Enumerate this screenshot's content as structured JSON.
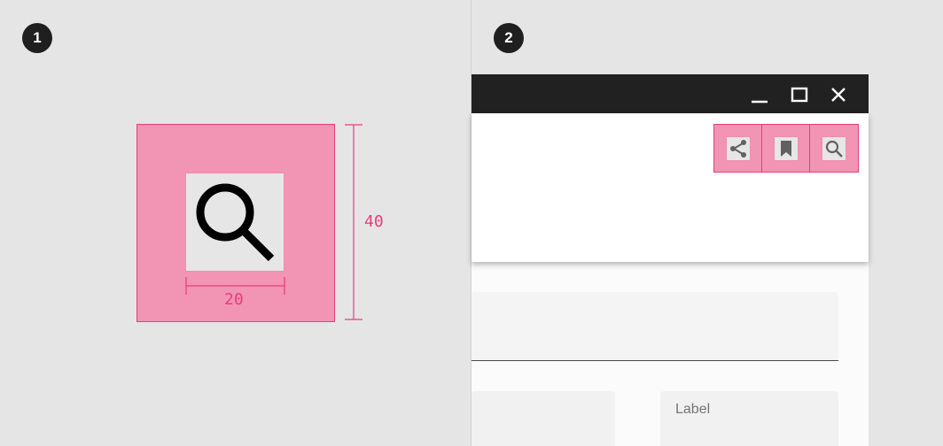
{
  "panel_left": {
    "step_number": "1",
    "icon_size_label": "20",
    "touch_target_label": "40",
    "icon": "search-icon",
    "colors": {
      "touch_target_fill": "#f294b4",
      "measure_line": "#e63e7c"
    }
  },
  "panel_right": {
    "step_number": "2",
    "window_controls": [
      "minimize-icon",
      "maximize-icon",
      "close-icon"
    ],
    "app_bar_actions": [
      "share-icon",
      "bookmark-icon",
      "search-icon"
    ],
    "text_field": {
      "label": "Label"
    },
    "colors": {
      "title_bar": "#212121",
      "app_bar": "#ffffff"
    }
  }
}
